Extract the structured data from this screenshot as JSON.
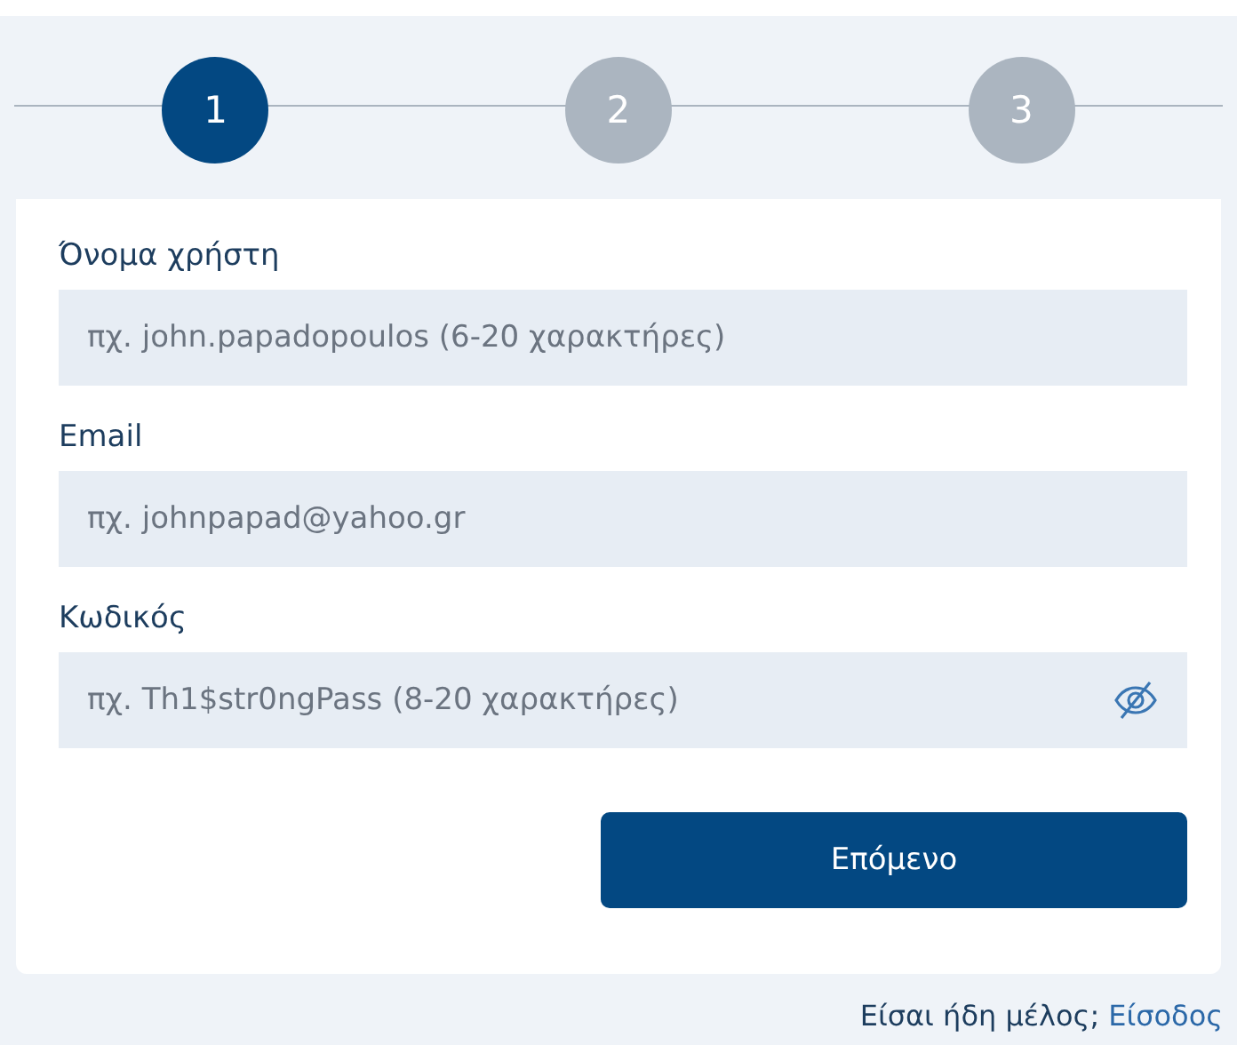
{
  "steps": [
    {
      "label": "1",
      "selected": true
    },
    {
      "label": "2",
      "selected": false
    },
    {
      "label": "3",
      "selected": false
    }
  ],
  "fields": [
    {
      "label": "Όνομα χρήστη",
      "placeholder": "πχ. john.papadopoulos (6-20 χαρακτήρες)",
      "kind": "text"
    },
    {
      "label": "Email",
      "placeholder": "πχ. johnpapad@yahoo.gr",
      "kind": "text"
    },
    {
      "label": "Κωδικός",
      "placeholder": "πχ. Th1$str0ngPass (8-20 χαρακτήρες)",
      "kind": "password"
    }
  ],
  "next_button": "Επόμενο",
  "footer": {
    "question": "Είσαι ήδη μέλος;",
    "link": "Είσοδος"
  }
}
